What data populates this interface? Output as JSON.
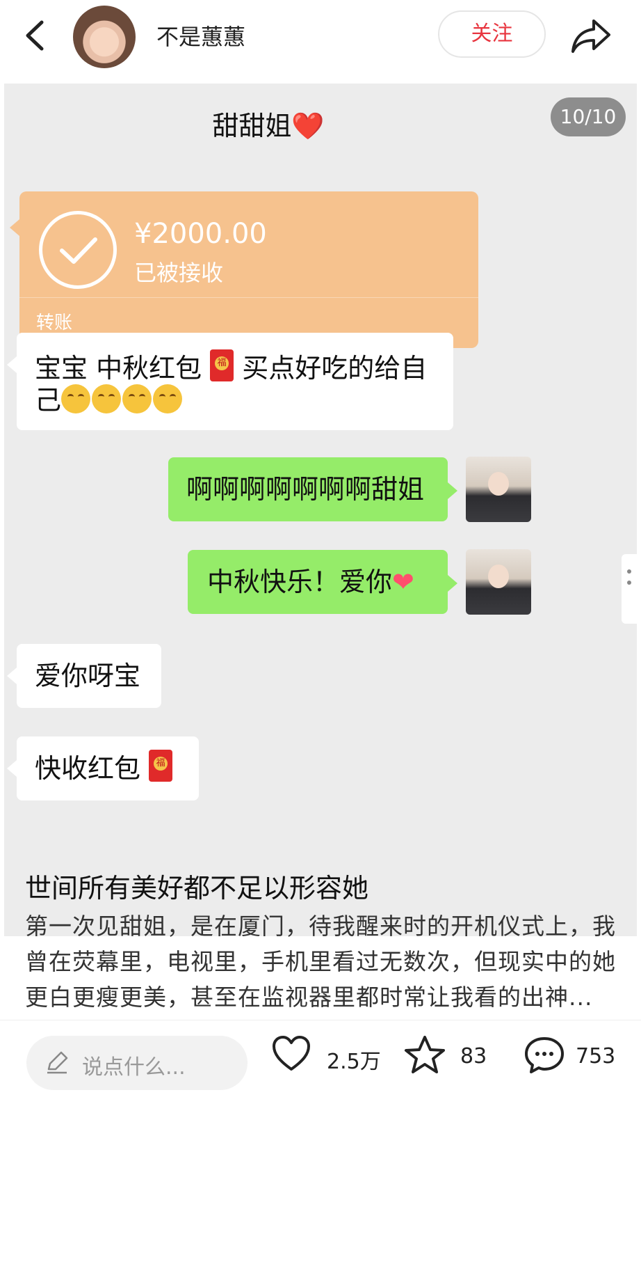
{
  "header": {
    "username": "不是蕙蕙",
    "follow_label": "关注"
  },
  "screenshot": {
    "chat_title": "甜甜姐",
    "counter": "10/10",
    "transfer": {
      "amount": "¥2000.00",
      "status": "已被接收",
      "label": "转账"
    },
    "messages": [
      {
        "side": "left",
        "text_a": "宝宝 中秋红包",
        "text_b": " 买点好吃的给自",
        "text_c": "己"
      },
      {
        "side": "right",
        "text": "啊啊啊啊啊啊啊甜姐"
      },
      {
        "side": "right",
        "text": "中秋快乐！爱你"
      },
      {
        "side": "left",
        "text": "爱你呀宝"
      },
      {
        "side": "left",
        "text": "快收红包"
      }
    ]
  },
  "post": {
    "title": "世间所有美好都不足以形容她",
    "body": "第一次见甜姐，是在厦门，待我醒来时的开机仪式上，我曾在荧幕里，电视里，手机里看过无数次，但现实中的她更白更瘦更美，甚至在监视器里都时常让我看的出神..."
  },
  "bottom_bar": {
    "comment_placeholder": "说点什么...",
    "likes": "2.5万",
    "favorites": "83",
    "comments": "753"
  }
}
